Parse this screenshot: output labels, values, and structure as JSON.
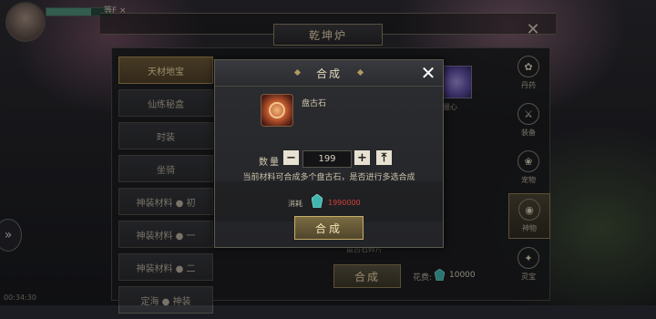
{
  "hud": {
    "level": "等F ×",
    "time": "00:34:30"
  },
  "window": {
    "title": "乾坤炉"
  },
  "menu": {
    "items": [
      {
        "label": "天材地宝",
        "active": true
      },
      {
        "label": "仙练秘盒",
        "active": false
      },
      {
        "label": "时装",
        "active": false
      },
      {
        "label": "坐骑",
        "active": false
      },
      {
        "label": "神装材料 ● 初",
        "active": false
      },
      {
        "label": "神装材料 ● 一",
        "active": false
      },
      {
        "label": "神装材料 ● 二",
        "active": false
      },
      {
        "label": "定海 ● 神装",
        "active": false
      }
    ]
  },
  "background_panel": {
    "item_label_top_right": "无量心",
    "item_label_bottom": "盘古石碎片",
    "synth_button": "合成",
    "cost_label": "花费:",
    "cost_value": "10000"
  },
  "sidebar": {
    "items": [
      {
        "label": "丹药",
        "icon": "pill-icon",
        "glyph": "✿",
        "active": false
      },
      {
        "label": "装备",
        "icon": "sword-icon",
        "glyph": "⚔",
        "active": false
      },
      {
        "label": "宠物",
        "icon": "paw-icon",
        "glyph": "❀",
        "active": false
      },
      {
        "label": "神物",
        "icon": "orb-icon",
        "glyph": "◉",
        "active": true
      },
      {
        "label": "灵宝",
        "icon": "treasure-icon",
        "glyph": "✦",
        "active": false
      }
    ]
  },
  "modal": {
    "title": "合成",
    "item_name": "盘古石",
    "quantity_label": "数量",
    "quantity_value": "199",
    "hint": "当前材料可合成多个盘古石，是否进行多选合成",
    "consume_label": "消耗",
    "consume_value": "1990000",
    "confirm_button": "合成"
  },
  "colors": {
    "accent_gold": "#c7ad6a",
    "consume_red": "#d2413a",
    "gem_teal": "#3fb6b0"
  }
}
